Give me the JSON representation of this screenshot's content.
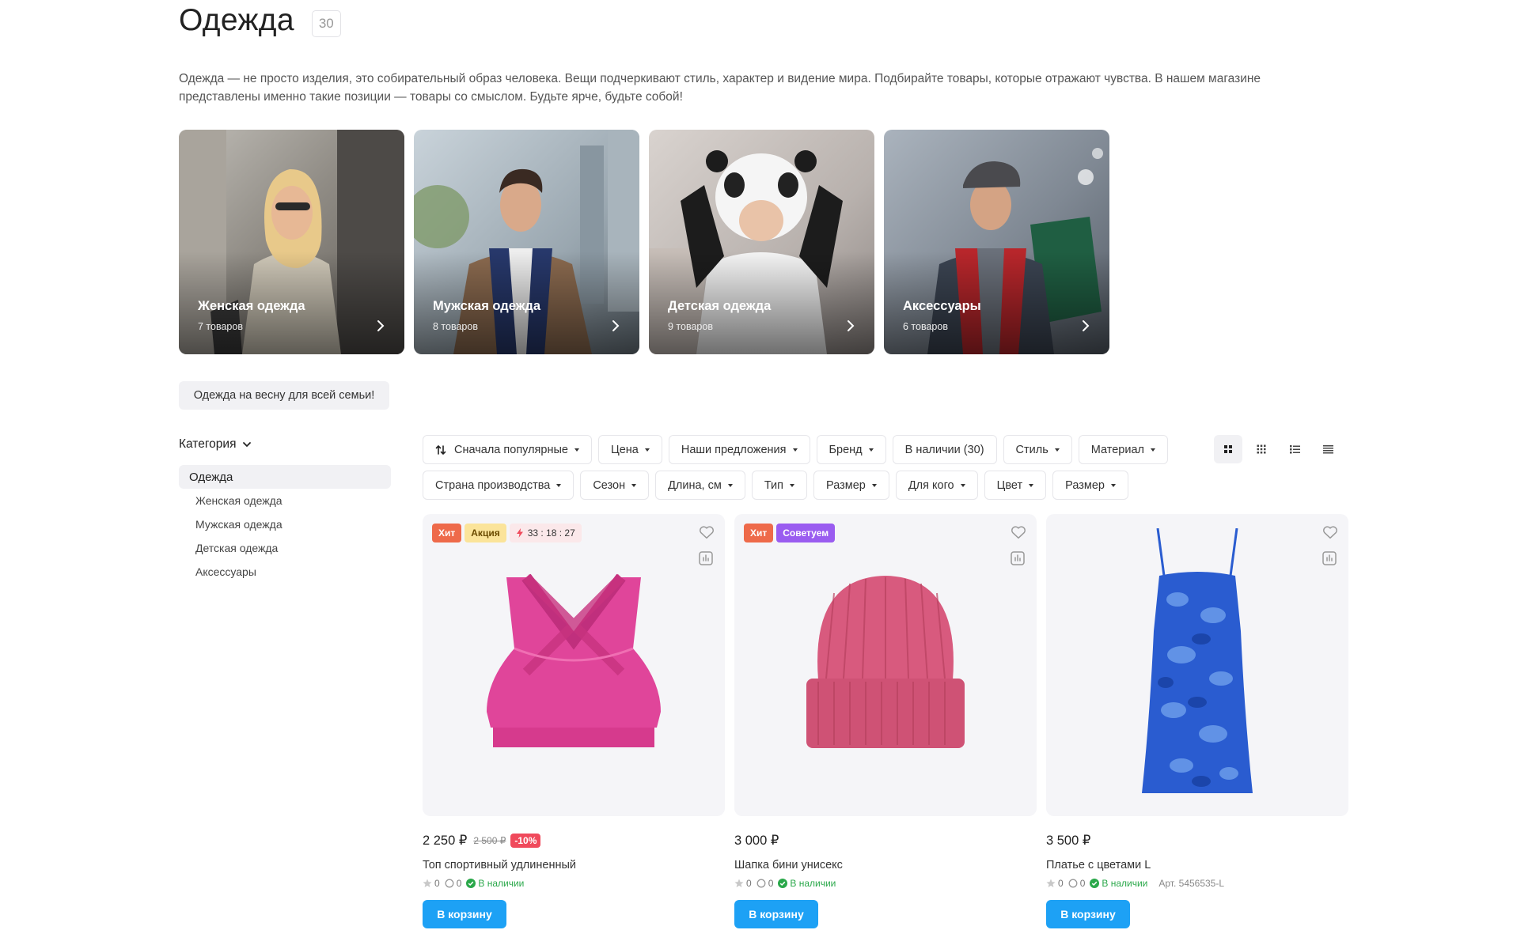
{
  "page": {
    "title": "Одежда",
    "count": "30",
    "description": "Одежда — не просто изделия, это собирательный образ человека. Вещи подчеркивают стиль, характер и видение мира. Подбирайте товары, которые отражают чувства. В нашем магазине представлены именно такие позиции — товары со смыслом. Будьте ярче, будьте собой!"
  },
  "categories": [
    {
      "name": "Женская одежда",
      "count": "7 товаров"
    },
    {
      "name": "Мужская одежда",
      "count": "8 товаров"
    },
    {
      "name": "Детская одежда",
      "count": "9 товаров"
    },
    {
      "name": "Аксессуары",
      "count": "6 товаров"
    }
  ],
  "promo_tag": "Одежда на весну для всей семьи!",
  "sidebar": {
    "heading": "Категория",
    "active": "Одежда",
    "items": [
      "Женская одежда",
      "Мужская одежда",
      "Детская одежда",
      "Аксессуары"
    ]
  },
  "filters": {
    "row1": [
      "Сначала популярные",
      "Цена",
      "Наши предложения",
      "Бренд",
      "В наличии (30)",
      "Стиль",
      "Материал"
    ],
    "row2": [
      "Страна производства",
      "Сезон",
      "Длина, см",
      "Тип",
      "Размер",
      "Для кого",
      "Цвет",
      "Размер"
    ]
  },
  "view_modes": [
    "grid-large-icon",
    "grid-small-icon",
    "list-icon",
    "table-icon"
  ],
  "products": [
    {
      "badges": {
        "hit": "Хит",
        "sale": "Акция",
        "timer": "33 : 18 : 27"
      },
      "price": "2 250 ₽",
      "old_price": "2 500 ₽",
      "discount": "-10%",
      "name": "Топ спортивный удлиненный",
      "rating": "0",
      "reviews": "0",
      "stock": "В наличии",
      "cart": "В корзину",
      "color": "#e0459a"
    },
    {
      "badges": {
        "hit": "Хит",
        "rec": "Советуем"
      },
      "price": "3 000 ₽",
      "name": "Шапка бини унисекс",
      "rating": "0",
      "reviews": "0",
      "stock": "В наличии",
      "cart": "В корзину",
      "color": "#d85a7e"
    },
    {
      "badges": {},
      "price": "3 500 ₽",
      "name": "Платье с цветами L",
      "rating": "0",
      "reviews": "0",
      "stock": "В наличии",
      "sku": "Арт. 5456535-L",
      "cart": "В корзину",
      "color": "#2a5cd0"
    }
  ],
  "colors": {
    "accent": "#1da1f5",
    "hit": "#ee6a4a",
    "sale": "#fbe49a",
    "recommend": "#9a5cf0",
    "discount": "#f04a5c",
    "in_stock": "#2aa84a"
  }
}
